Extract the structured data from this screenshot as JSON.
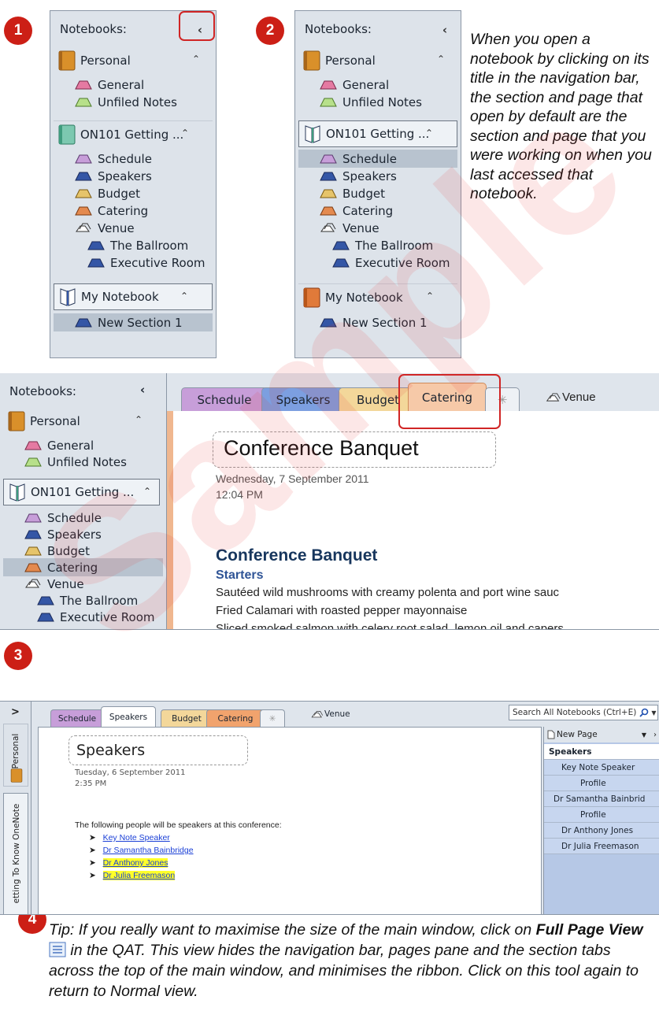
{
  "steps": [
    "1",
    "2",
    "3",
    "4"
  ],
  "nav": {
    "title": "Notebooks:",
    "notebooks": [
      {
        "name": "Personal",
        "sections": [
          "General",
          "Unfiled Notes"
        ]
      },
      {
        "name": "ON101 Getting ...",
        "sections": [
          "Schedule",
          "Speakers",
          "Budget",
          "Catering",
          "Venue",
          "The Ballroom",
          "Executive Room"
        ]
      },
      {
        "name": "My Notebook",
        "sections": [
          "New Section 1"
        ]
      }
    ]
  },
  "caption2": "When you open a notebook by clicking on its title in the navigation bar, the section and page that open by default are the section and page that you were working on when you last accessed that notebook.",
  "shot3": {
    "tabs": [
      "Schedule",
      "Speakers",
      "Budget",
      "Catering",
      "Venue"
    ],
    "page_title": "Conference Banquet",
    "date": "Wednesday, 7 September  2011",
    "time": "12:04 PM",
    "heading": "Conference Banquet",
    "subheading": "Starters",
    "lines": [
      "Sautéed wild mushrooms with creamy polenta and port wine sauc",
      "Fried Calamari with roasted pepper mayonnaise",
      "Sliced smoked salmon with celery root salad, lemon oil and capers"
    ]
  },
  "shot4": {
    "collapsed_nav": [
      ">",
      "Personal",
      "etting To Know OneNote"
    ],
    "tabs": [
      "Schedule",
      "Speakers",
      "Budget",
      "Catering",
      "Venue"
    ],
    "search_placeholder": "Search All Notebooks (Ctrl+E)",
    "page_title": "Speakers",
    "date": "Tuesday, 6 September  2011",
    "time": "2:35 PM",
    "intro": "The following people will be speakers at this conference:",
    "bullets": [
      "Key Note Speaker",
      "Dr Samantha Bainbridge",
      "Dr Anthony Jones",
      "Dr Julia Freemason"
    ],
    "new_page": "New Page",
    "pages": [
      "Speakers",
      "Key Note Speaker",
      "Profile",
      "Dr Samantha Bainbrid",
      "Profile",
      "Dr Anthony Jones",
      "Dr Julia Freemason"
    ]
  },
  "tip": {
    "text_before": "Tip: If you really want to maximise the size of the main window, click on ",
    "bold": "Full Page View",
    "text_after": " in the QAT. This view hides the navigation bar, pages pane and the section tabs across the top of the main window, and minimises the ribbon. Click on this tool again to return to Normal view."
  },
  "watermark": "Sample",
  "colors": {
    "badge": "#cc1f16",
    "callout": "#d02525",
    "purple": "#c79ed9",
    "blue": "#3456a6",
    "yellow": "#e6c46a",
    "orange": "#e48a4f",
    "teal": "#7cc8b0",
    "pink": "#e57aa2",
    "green": "#b7e08a"
  }
}
